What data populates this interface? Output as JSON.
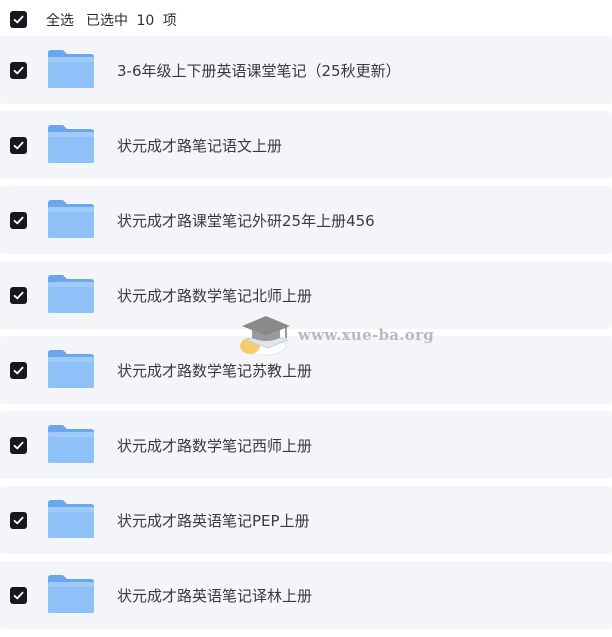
{
  "header": {
    "select_all_label": "全选",
    "selected_count_text": "已选中 10 项"
  },
  "folders": [
    {
      "name": "3-6年级上下册英语课堂笔记（25秋更新）",
      "checked": true
    },
    {
      "name": "状元成才路笔记语文上册",
      "checked": true
    },
    {
      "name": "状元成才路课堂笔记外研25年上册456",
      "checked": true
    },
    {
      "name": "状元成才路数学笔记北师上册",
      "checked": true
    },
    {
      "name": "状元成才路数学笔记苏教上册",
      "checked": true
    },
    {
      "name": "状元成才路数学笔记西师上册",
      "checked": true
    },
    {
      "name": "状元成才路英语笔记PEP上册",
      "checked": true
    },
    {
      "name": "状元成才路英语笔记译林上册",
      "checked": true
    }
  ],
  "watermark": {
    "text": "www.xue-ba.org",
    "icon": "graduation-cap-icon"
  },
  "colors": {
    "checkbox": "#16171f",
    "row_background": "#f4f5f8",
    "folder_front": "#8ec1f7",
    "folder_back": "#6aa7ef"
  }
}
